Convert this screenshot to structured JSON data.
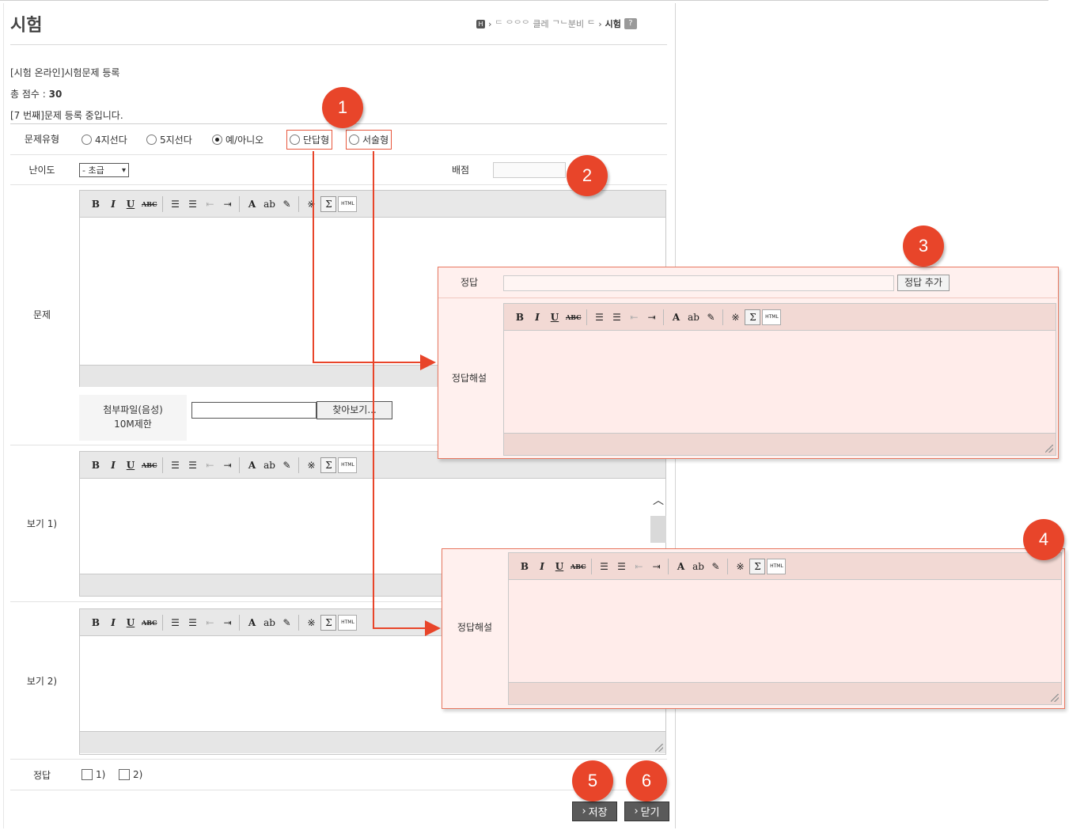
{
  "page": {
    "title": "시험",
    "breadcrumb": {
      "home_glyph": "H",
      "items": [
        "›",
        "ᄃ ᄋᄋᄋ",
        "클레",
        "ᄀᄂ분비",
        "ᄃ",
        "›"
      ],
      "current": "시험",
      "help_glyph": "?"
    }
  },
  "info": {
    "line1": "[시험 온라인]시험문제 등록",
    "score_label": "총 점수 : ",
    "score_value": "30",
    "line3": "[7 번째]문제 등록 중입니다."
  },
  "form": {
    "type_label": "문제유형",
    "type_options": [
      {
        "label": "4지선다",
        "selected": false
      },
      {
        "label": "5지선다",
        "selected": false
      },
      {
        "label": "예/아니오",
        "selected": true
      },
      {
        "label": "단답형",
        "selected": false
      },
      {
        "label": "서술형",
        "selected": false
      }
    ],
    "difficulty_label": "난이도",
    "difficulty_value": "- 초급",
    "points_label": "배점",
    "question_label": "문제",
    "attach_label_line1": "첨부파일(음성)",
    "attach_label_line2": "10M제한",
    "browse_label": "찾아보기...",
    "choice1_label": "보기 1)",
    "choice2_label": "보기 2)",
    "answer_label": "정답",
    "answer_options": [
      "1)",
      "2)"
    ],
    "save_label": "저장",
    "close_label": "닫기"
  },
  "toolbar": {
    "bold": "B",
    "italic": "I",
    "underline": "U",
    "strike": "ABC",
    "ol": "☰",
    "ul": "☰",
    "outdent": "⇤",
    "indent": "⇥",
    "font_color": "A",
    "highlight": "ab",
    "edit": "✎",
    "special": "※",
    "sigma": "Σ",
    "html": "HTML"
  },
  "popup1": {
    "answer_label": "정답",
    "add_answer_label": "정답 추가",
    "explanation_label": "정답해설"
  },
  "popup2": {
    "explanation_label": "정답해설"
  },
  "callouts": [
    "1",
    "2",
    "3",
    "4",
    "5",
    "6"
  ],
  "colors": {
    "accent": "#e8452a",
    "popup_bg": "#fff0ee",
    "popup_border": "#e87760"
  }
}
